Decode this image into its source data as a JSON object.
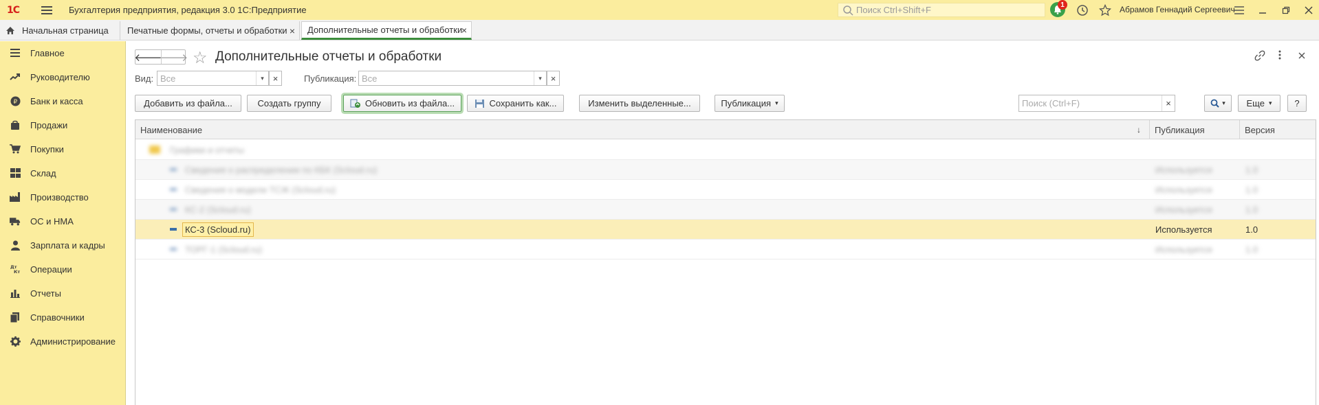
{
  "app": {
    "logo_text": "1С",
    "title": "Бухгалтерия предприятия, редакция 3.0 1С:Предприятие",
    "search_placeholder": "Поиск Ctrl+Shift+F",
    "notifications_count": "1",
    "user_name": "Абрамов Геннадий Сергеевич"
  },
  "tabs": [
    {
      "label": "Начальная страница"
    },
    {
      "label": "Печатные формы, отчеты и обработки",
      "close": "×"
    },
    {
      "label": "Дополнительные отчеты и обработки",
      "close": "×"
    }
  ],
  "sidebar": {
    "items": [
      {
        "label": "Главное",
        "icon": "menu-icon"
      },
      {
        "label": "Руководителю",
        "icon": "trend-icon"
      },
      {
        "label": "Банк и касса",
        "icon": "ruble-icon"
      },
      {
        "label": "Продажи",
        "icon": "bag-icon"
      },
      {
        "label": "Покупки",
        "icon": "cart-icon"
      },
      {
        "label": "Склад",
        "icon": "warehouse-icon"
      },
      {
        "label": "Производство",
        "icon": "factory-icon"
      },
      {
        "label": "ОС и НМА",
        "icon": "truck-icon"
      },
      {
        "label": "Зарплата и кадры",
        "icon": "person-icon"
      },
      {
        "label": "Операции",
        "icon": "dt-kt-icon"
      },
      {
        "label": "Отчеты",
        "icon": "bar-chart-icon"
      },
      {
        "label": "Справочники",
        "icon": "books-icon"
      },
      {
        "label": "Администрирование",
        "icon": "gear-icon"
      }
    ]
  },
  "page": {
    "title": "Дополнительные отчеты и обработки",
    "filter_view_label": "Вид:",
    "filter_view_placeholder": "Все",
    "filter_pub_label": "Публикация:",
    "filter_pub_placeholder": "Все",
    "search_placeholder": "Поиск (Ctrl+F)"
  },
  "toolbar": {
    "add_from_file": "Добавить из файла...",
    "create_group": "Создать группу",
    "update_from_file": "Обновить из файла...",
    "save_as": "Сохранить как...",
    "change_selected": "Изменить выделенные...",
    "publication": "Публикация",
    "more": "Еще",
    "help": "?"
  },
  "table": {
    "columns": [
      "Наименование",
      "Публикация",
      "Версия"
    ],
    "sort_indicator": "↓",
    "rows": [
      {
        "name": "Графики и отчеты",
        "publication": "",
        "version": "",
        "type": "group",
        "hidden": true
      },
      {
        "name": "Сведения о распределении по КБК (Scloud.ru)",
        "publication": "Используется",
        "version": "1.0",
        "type": "item",
        "hidden": true
      },
      {
        "name": "Сведения о модели ТСЖ (Scloud.ru)",
        "publication": "Используется",
        "version": "1.0",
        "type": "item",
        "hidden": true
      },
      {
        "name": "КС-2 (Scloud.ru)",
        "publication": "Используется",
        "version": "1.0",
        "type": "item",
        "hidden": true
      },
      {
        "name": "КС-3 (Scloud.ru)",
        "publication": "Используется",
        "version": "1.0",
        "type": "item",
        "hidden": false,
        "selected": true
      },
      {
        "name": "ТОРГ-1 (Scloud.ru)",
        "publication": "Используется",
        "version": "1.0",
        "type": "item",
        "hidden": true
      }
    ]
  }
}
